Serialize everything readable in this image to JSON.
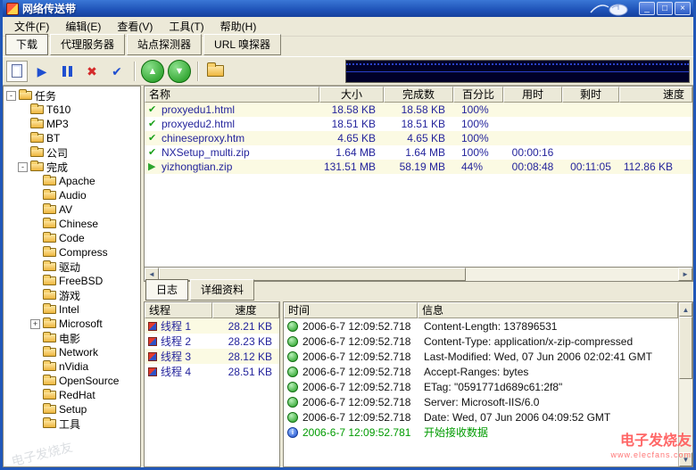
{
  "window": {
    "title": "网络传送带",
    "controls": {
      "minimize": "_",
      "maximize": "□",
      "close": "×"
    }
  },
  "menu": {
    "items": [
      "文件(F)",
      "编辑(E)",
      "查看(V)",
      "工具(T)",
      "帮助(H)"
    ]
  },
  "tabs": {
    "items": [
      {
        "label": "下载",
        "state": "active"
      },
      {
        "label": "代理服务器",
        "state": "normal"
      },
      {
        "label": "站点探测器",
        "state": "normal"
      },
      {
        "label": "URL 嗅探器",
        "state": "normal"
      }
    ]
  },
  "toolbar": {
    "buttons": [
      "new-task",
      "start",
      "pause",
      "delete",
      "confirm",
      "move-up",
      "move-down",
      "open-folder"
    ],
    "glyphs": {
      "start": "▶",
      "delete": "✖",
      "confirm": "✔",
      "up": "▲",
      "down": "▼"
    }
  },
  "scrollbar": {
    "left": "◄",
    "right": "►",
    "up": "▲",
    "down": "▼"
  },
  "sidebar": {
    "items": [
      {
        "label": "任务",
        "depth": 0,
        "expander": "-"
      },
      {
        "label": "T610",
        "depth": 1,
        "expander": ""
      },
      {
        "label": "MP3",
        "depth": 1,
        "expander": ""
      },
      {
        "label": "BT",
        "depth": 1,
        "expander": ""
      },
      {
        "label": "公司",
        "depth": 1,
        "expander": ""
      },
      {
        "label": "完成",
        "depth": 1,
        "expander": "-"
      },
      {
        "label": "Apache",
        "depth": 2,
        "expander": ""
      },
      {
        "label": "Audio",
        "depth": 2,
        "expander": ""
      },
      {
        "label": "AV",
        "depth": 2,
        "expander": ""
      },
      {
        "label": "Chinese",
        "depth": 2,
        "expander": ""
      },
      {
        "label": "Code",
        "depth": 2,
        "expander": ""
      },
      {
        "label": "Compress",
        "depth": 2,
        "expander": ""
      },
      {
        "label": "驱动",
        "depth": 2,
        "expander": ""
      },
      {
        "label": "FreeBSD",
        "depth": 2,
        "expander": ""
      },
      {
        "label": "游戏",
        "depth": 2,
        "expander": ""
      },
      {
        "label": "Intel",
        "depth": 2,
        "expander": ""
      },
      {
        "label": "Microsoft",
        "depth": 2,
        "expander": "+"
      },
      {
        "label": "电影",
        "depth": 2,
        "expander": ""
      },
      {
        "label": "Network",
        "depth": 2,
        "expander": ""
      },
      {
        "label": "nVidia",
        "depth": 2,
        "expander": ""
      },
      {
        "label": "OpenSource",
        "depth": 2,
        "expander": ""
      },
      {
        "label": "RedHat",
        "depth": 2,
        "expander": ""
      },
      {
        "label": "Setup",
        "depth": 2,
        "expander": ""
      },
      {
        "label": "工具",
        "depth": 2,
        "expander": ""
      }
    ]
  },
  "task_table": {
    "columns": [
      {
        "key": "name",
        "label": "名称"
      },
      {
        "key": "size",
        "label": "大小"
      },
      {
        "key": "done",
        "label": "完成数"
      },
      {
        "key": "percent",
        "label": "百分比"
      },
      {
        "key": "used",
        "label": "用时"
      },
      {
        "key": "remain",
        "label": "剩时"
      },
      {
        "key": "speed",
        "label": "速度"
      }
    ],
    "rows": [
      {
        "icon": "check",
        "name": "proxyedu1.html",
        "size": "18.58 KB",
        "done": "18.58 KB",
        "percent": "100%",
        "used": "",
        "remain": "",
        "speed": ""
      },
      {
        "icon": "check",
        "name": "proxyedu2.html",
        "size": "18.51 KB",
        "done": "18.51 KB",
        "percent": "100%",
        "used": "",
        "remain": "",
        "speed": ""
      },
      {
        "icon": "check",
        "name": "chineseproxy.htm",
        "size": "4.65 KB",
        "done": "4.65 KB",
        "percent": "100%",
        "used": "",
        "remain": "",
        "speed": ""
      },
      {
        "icon": "check",
        "name": "NXSetup_multi.zip",
        "size": "1.64 MB",
        "done": "1.64 MB",
        "percent": "100%",
        "used": "00:00:16",
        "remain": "",
        "speed": ""
      },
      {
        "icon": "active",
        "name": "yizhongtian.zip",
        "size": "131.51 MB",
        "done": "58.19 MB",
        "percent": "44%",
        "used": "00:08:48",
        "remain": "00:11:05",
        "speed": "112.86 KB"
      }
    ]
  },
  "bottom": {
    "tabs": [
      {
        "label": "日志",
        "state": "active"
      },
      {
        "label": "详细资料",
        "state": "normal"
      }
    ],
    "thread_table": {
      "columns": [
        {
          "key": "name",
          "label": "线程"
        },
        {
          "key": "speed",
          "label": "速度"
        }
      ],
      "rows": [
        {
          "name": "线程 1",
          "speed": "28.21 KB"
        },
        {
          "name": "线程 2",
          "speed": "28.23 KB"
        },
        {
          "name": "线程 3",
          "speed": "28.12 KB"
        },
        {
          "name": "线程 4",
          "speed": "28.51 KB"
        }
      ]
    },
    "log_table": {
      "columns": [
        {
          "key": "time",
          "label": "时间"
        },
        {
          "key": "info",
          "label": "信息"
        }
      ],
      "rows": [
        {
          "type": "net",
          "time": "2006-6-7 12:09:52.718",
          "info": "Content-Length: 137896531"
        },
        {
          "type": "net",
          "time": "2006-6-7 12:09:52.718",
          "info": "Content-Type: application/x-zip-compressed"
        },
        {
          "type": "net",
          "time": "2006-6-7 12:09:52.718",
          "info": "Last-Modified: Wed, 07 Jun 2006 02:02:41 GMT"
        },
        {
          "type": "net",
          "time": "2006-6-7 12:09:52.718",
          "info": "Accept-Ranges: bytes"
        },
        {
          "type": "net",
          "time": "2006-6-7 12:09:52.718",
          "info": "ETag: \"0591771d689c61:2f8\""
        },
        {
          "type": "net",
          "time": "2006-6-7 12:09:52.718",
          "info": "Server: Microsoft-IIS/6.0"
        },
        {
          "type": "net",
          "time": "2006-6-7 12:09:52.718",
          "info": "Date: Wed, 07 Jun 2006 04:09:52 GMT"
        },
        {
          "type": "start",
          "time": "2006-6-7 12:09:52.781",
          "info": "开始接收数据"
        }
      ]
    }
  },
  "watermark": {
    "line1": "电子发烧友",
    "line2": "www.elecfans.com",
    "faint": "电子发烧友"
  },
  "colors": {
    "titlebar_blue": "#1e52b7",
    "row_alt_yellow": "#fbfae3",
    "task_text_navy": "#24249c",
    "log_green": "#009b00",
    "watermark_red": "#ff5a5a",
    "graph_bg": "#000028",
    "accent_green": "#1e9e1e"
  }
}
